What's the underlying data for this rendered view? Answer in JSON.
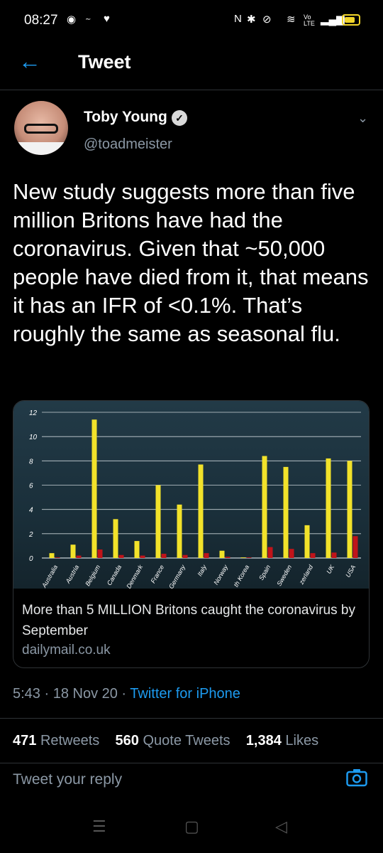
{
  "status_bar": {
    "time": "08:27",
    "network": "Vo LTE"
  },
  "header": {
    "title": "Tweet"
  },
  "tweet": {
    "author_name": "Toby Young",
    "handle": "@toadmeister",
    "text": "New study suggests more than five million Britons have had the coronavirus. Given that ~50,000 people have died from it, that means it has an IFR of <0.1%. That’s roughly the same as seasonal flu.",
    "time": "5:43 · 18 Nov 20 · ",
    "source": "Twitter for iPhone"
  },
  "card": {
    "title": "More than 5 MILLION Britons caught the coronavirus by September",
    "domain": "dailymail.co.uk"
  },
  "stats": {
    "retweets_count": "471",
    "retweets_label": "Retweets",
    "quotes_count": "560",
    "quotes_label": "Quote Tweets",
    "likes_count": "1,384",
    "likes_label": "Likes"
  },
  "reply": {
    "placeholder": "Tweet your reply"
  },
  "colors": {
    "accent": "#1d9bf0",
    "bar_yellow": "#f2e22a",
    "bar_red": "#c0141a"
  },
  "chart_data": {
    "type": "bar",
    "categories": [
      "Australia",
      "Austria",
      "Belgium",
      "Canada",
      "Denmark",
      "France",
      "Germany",
      "Italy",
      "Norway",
      "th Korea",
      "Spain",
      "Sweden",
      "zerland",
      "UK",
      "USA"
    ],
    "series": [
      {
        "values": [
          0.4,
          1.1,
          11.4,
          3.2,
          1.4,
          6.0,
          4.4,
          7.7,
          0.6,
          0.05,
          8.4,
          7.5,
          2.7,
          8.2,
          8.0
        ]
      },
      {
        "values": [
          0.05,
          0.2,
          0.7,
          0.25,
          0.2,
          0.35,
          0.25,
          0.4,
          0.1,
          0.05,
          0.9,
          0.75,
          0.4,
          0.45,
          1.8
        ]
      }
    ],
    "yticks": [
      "0",
      "2",
      "4",
      "6",
      "8",
      "10",
      "12"
    ],
    "ylim": [
      0,
      12
    ],
    "grid": true
  }
}
